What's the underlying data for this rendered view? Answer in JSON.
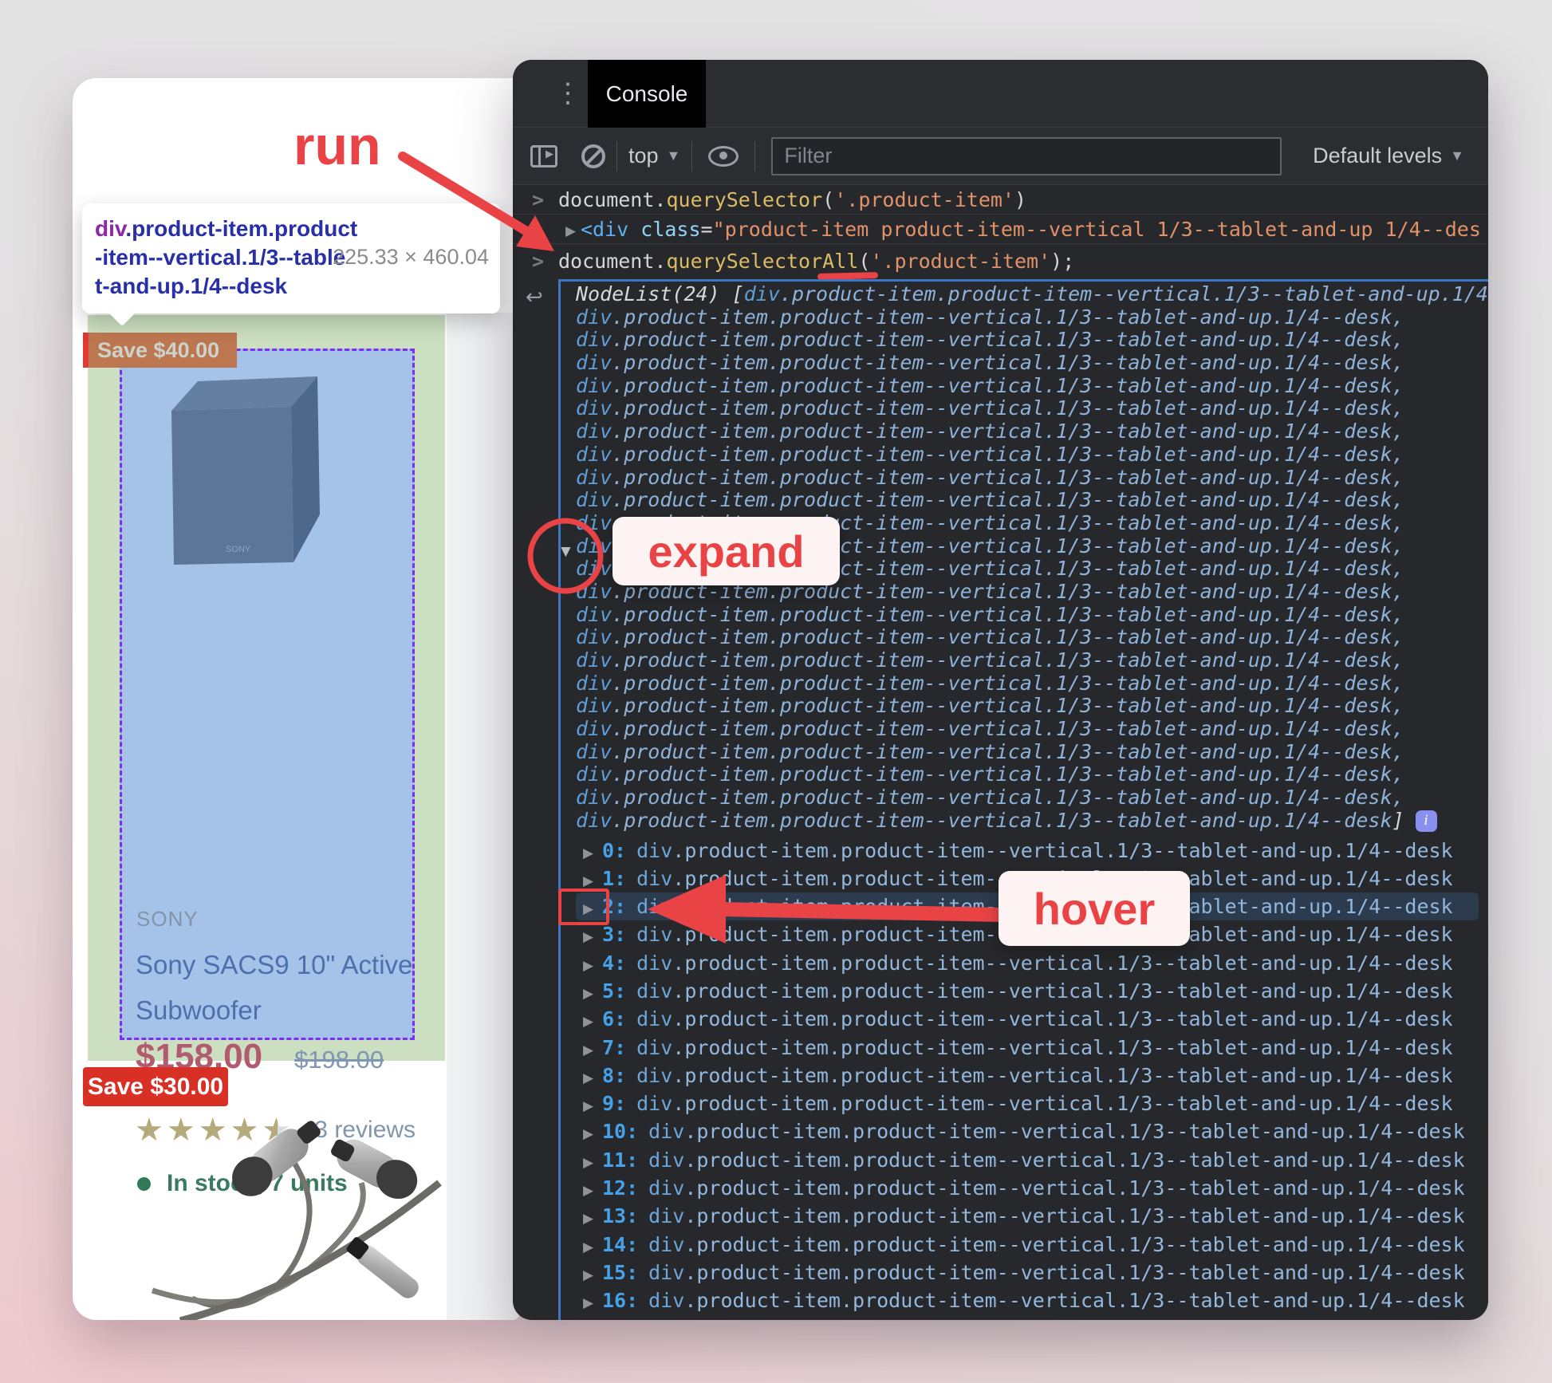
{
  "annotations": {
    "run_label": "run",
    "expand_label": "expand",
    "hover_label": "hover"
  },
  "tooltip": {
    "tag": "div",
    "classes_line1": ".product-item.product",
    "classes_line2": "-item--vertical.1/3--table",
    "classes_line3": "t-and-up.1/4--desk",
    "dimensions": "225.33 × 460.04"
  },
  "product": {
    "badge_top": "Save $40.00",
    "brand": "SONY",
    "title_line1": "Sony SACS9 10\" Active",
    "title_line2": "Subwoofer",
    "price": "$158.00",
    "old_price": "$198.00",
    "rating": 4.5,
    "stars_glyphs": "★★★★★",
    "reviews": "3 reviews",
    "stock": "In stock, 7 units",
    "badge_bottom": "Save $30.00"
  },
  "devtools": {
    "tab": "Console",
    "toolbar": {
      "context": "top",
      "filter_placeholder": "Filter",
      "levels": "Default levels"
    },
    "cmd1": {
      "obj": "document",
      "dot": ".",
      "fn": "querySelector",
      "open": "(",
      "arg": "'.product-item'",
      "close": ")"
    },
    "result1": {
      "tag": "<div",
      "attr": "class",
      "eq": "=",
      "value": "\"product-item product-item--vertical  1/3--tablet-and-up 1/4--des"
    },
    "cmd2": {
      "obj": "document",
      "dot": ".",
      "fn_main": "querySelector",
      "fn_tail": "All",
      "open": "(",
      "arg": "'.product-item'",
      "close": ");"
    },
    "nodelist": {
      "label": "NodeList(24) ",
      "bracket": "[",
      "item_tag": "div",
      "item_rest": ".product-item.product-item--vertical.1/3--tablet-and-up.1/4--desk",
      "comma": ",",
      "close_bracket": "]",
      "info_badge": "i",
      "preview_repeat": 22,
      "expanded_count": 17,
      "hover_index": 2
    },
    "colors": {
      "selection_border": "#3e76c6",
      "annotation_red": "#ea4346",
      "badge_info": "#8b90f0"
    }
  }
}
